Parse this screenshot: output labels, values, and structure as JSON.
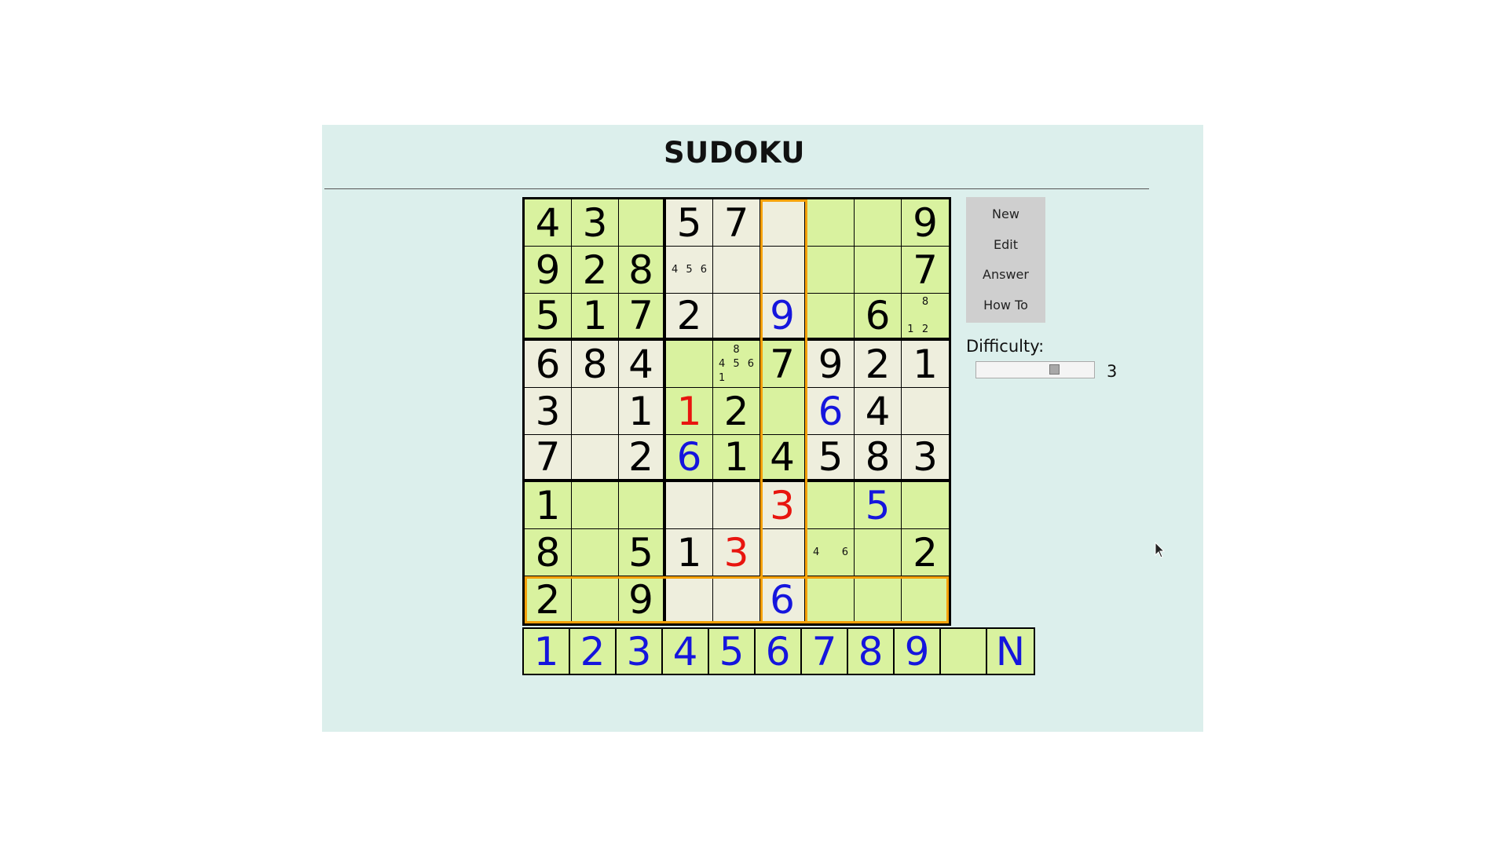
{
  "title": "SUDOKU",
  "buttons": {
    "new": "New",
    "edit": "Edit",
    "answer": "Answer",
    "how_to": "How To"
  },
  "difficulty": {
    "label": "Difficulty:",
    "value": "3",
    "level_fraction": 0.6
  },
  "colors": {
    "background": "#dcefec",
    "cell_green": "#d9f29f",
    "cell_light": "#eeeedd",
    "highlight": "#f5a10a",
    "user_digit": "#1515dd",
    "error_digit": "#e8150f"
  },
  "board": {
    "shading": [
      "GGGLLLGGG",
      "GGGLLLGGG",
      "GGGLLLGGG",
      "LLLGGGLLL",
      "LLLGGGLLL",
      "LLLGGGLLL",
      "GGGLLLGGG",
      "GGGLLLGGG",
      "GGGLLLGGG"
    ],
    "rows": [
      [
        {
          "v": "4",
          "t": "given"
        },
        {
          "v": "3",
          "t": "given"
        },
        {},
        {
          "v": "5",
          "t": "given"
        },
        {
          "v": "7",
          "t": "given"
        },
        {},
        {},
        {},
        {
          "v": "9",
          "t": "given"
        }
      ],
      [
        {
          "v": "9",
          "t": "given"
        },
        {
          "v": "2",
          "t": "given"
        },
        {
          "v": "8",
          "t": "given"
        },
        {
          "notes": [
            "",
            "",
            "",
            "4",
            "5",
            "6",
            "",
            "",
            ""
          ]
        },
        {},
        {},
        {},
        {},
        {
          "v": "7",
          "t": "given"
        }
      ],
      [
        {
          "v": "5",
          "t": "given"
        },
        {
          "v": "1",
          "t": "given"
        },
        {
          "v": "7",
          "t": "given"
        },
        {
          "v": "2",
          "t": "given"
        },
        {},
        {
          "v": "9",
          "t": "user"
        },
        {},
        {
          "v": "6",
          "t": "given"
        },
        {
          "notes": [
            "",
            "8",
            "",
            "",
            "",
            "",
            "1",
            "2",
            ""
          ]
        }
      ],
      [
        {
          "v": "6",
          "t": "given"
        },
        {
          "v": "8",
          "t": "given"
        },
        {
          "v": "4",
          "t": "given"
        },
        {},
        {
          "notes": [
            "",
            "8",
            "",
            "4",
            "5",
            "6",
            "1",
            "",
            ""
          ]
        },
        {
          "v": "7",
          "t": "given"
        },
        {
          "v": "9",
          "t": "given"
        },
        {
          "v": "2",
          "t": "given"
        },
        {
          "v": "1",
          "t": "given"
        }
      ],
      [
        {
          "v": "3",
          "t": "given"
        },
        {},
        {
          "v": "1",
          "t": "given"
        },
        {
          "v": "1",
          "t": "error"
        },
        {
          "v": "2",
          "t": "given"
        },
        {},
        {
          "v": "6",
          "t": "user"
        },
        {
          "v": "4",
          "t": "given"
        },
        {}
      ],
      [
        {
          "v": "7",
          "t": "given"
        },
        {},
        {
          "v": "2",
          "t": "given"
        },
        {
          "v": "6",
          "t": "user"
        },
        {
          "v": "1",
          "t": "given"
        },
        {
          "v": "4",
          "t": "given"
        },
        {
          "v": "5",
          "t": "given"
        },
        {
          "v": "8",
          "t": "given"
        },
        {
          "v": "3",
          "t": "given"
        }
      ],
      [
        {
          "v": "1",
          "t": "given"
        },
        {},
        {},
        {},
        {},
        {
          "v": "3",
          "t": "error"
        },
        {},
        {
          "v": "5",
          "t": "user"
        },
        {}
      ],
      [
        {
          "v": "8",
          "t": "given"
        },
        {},
        {
          "v": "5",
          "t": "given"
        },
        {
          "v": "1",
          "t": "given"
        },
        {
          "v": "3",
          "t": "error"
        },
        {},
        {
          "notes": [
            "",
            "",
            "",
            "4",
            "",
            "6",
            "",
            "",
            ""
          ]
        },
        {},
        {
          "v": "2",
          "t": "given"
        }
      ],
      [
        {
          "v": "2",
          "t": "given"
        },
        {},
        {
          "v": "9",
          "t": "given"
        },
        {},
        {},
        {
          "v": "6",
          "t": "user"
        },
        {},
        {},
        {}
      ]
    ],
    "highlight_row": 8,
    "highlight_col": 5
  },
  "palette": [
    "1",
    "2",
    "3",
    "4",
    "5",
    "6",
    "7",
    "8",
    "9",
    "",
    "N"
  ]
}
